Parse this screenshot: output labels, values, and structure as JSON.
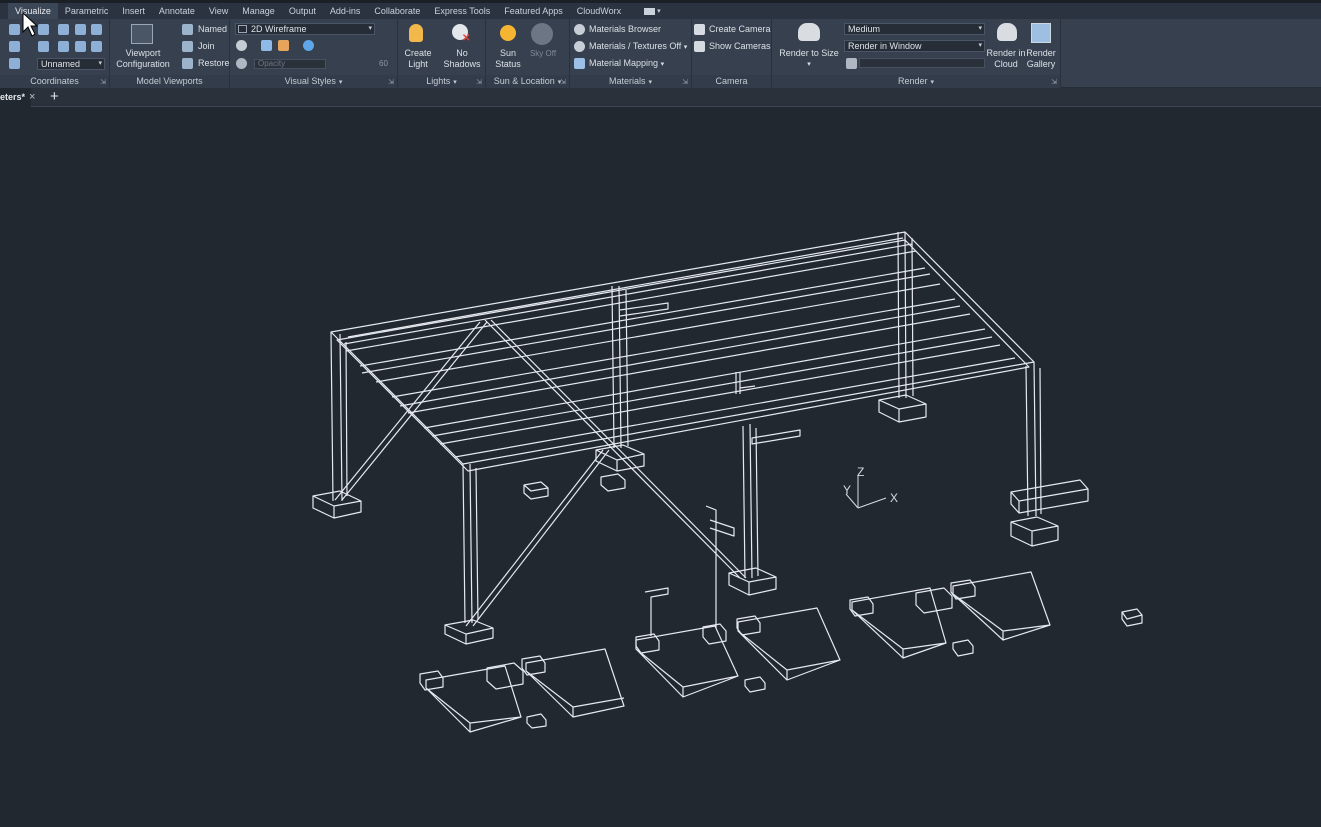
{
  "menu": {
    "tabs": [
      "Visualize",
      "Parametric",
      "Insert",
      "Annotate",
      "View",
      "Manage",
      "Output",
      "Add-ins",
      "Collaborate",
      "Express Tools",
      "Featured Apps",
      "CloudWorx"
    ],
    "active_tab": "Visualize"
  },
  "ribbon": {
    "coordinates": {
      "title": "Coordinates",
      "ucs_combo": "Unnamed"
    },
    "model_viewports": {
      "title": "Model Viewports",
      "viewport_config_line1": "Viewport",
      "viewport_config_line2": "Configuration",
      "named": "Named",
      "join": "Join",
      "restore": "Restore"
    },
    "visual_styles": {
      "title": "Visual Styles",
      "style_combo": "2D Wireframe",
      "opacity_label": "Opacity",
      "opacity_value": "60"
    },
    "lights": {
      "title": "Lights",
      "create_light_line1": "Create",
      "create_light_line2": "Light",
      "no_shadows_line1": "No",
      "no_shadows_line2": "Shadows"
    },
    "sun_location": {
      "title": "Sun & Location",
      "sun_status_line1": "Sun",
      "sun_status_line2": "Status",
      "sky_off": "Sky Off"
    },
    "materials": {
      "title": "Materials",
      "browser": "Materials Browser",
      "textures": "Materials / Textures Off",
      "mapping": "Material Mapping"
    },
    "camera": {
      "title": "Camera",
      "create_camera": "Create Camera",
      "show_cameras": "Show  Cameras"
    },
    "render": {
      "title": "Render",
      "render_to_size": "Render to Size",
      "quality_combo": "Medium",
      "output_combo": "Render in Window",
      "render_cloud_line1": "Render in",
      "render_cloud_line2": "Cloud",
      "render_gallery_line1": "Render",
      "render_gallery_line2": "Gallery"
    }
  },
  "document": {
    "tab_label": "eters*",
    "close_symbol": "×",
    "new_tab_symbol": "+"
  },
  "ucs_icon": {
    "z": "Z",
    "y": "Y",
    "x": "X"
  },
  "colors": {
    "ribbon_bg": "#36404f",
    "viewport_bg": "#212830",
    "wire": "#e6e9ee"
  }
}
